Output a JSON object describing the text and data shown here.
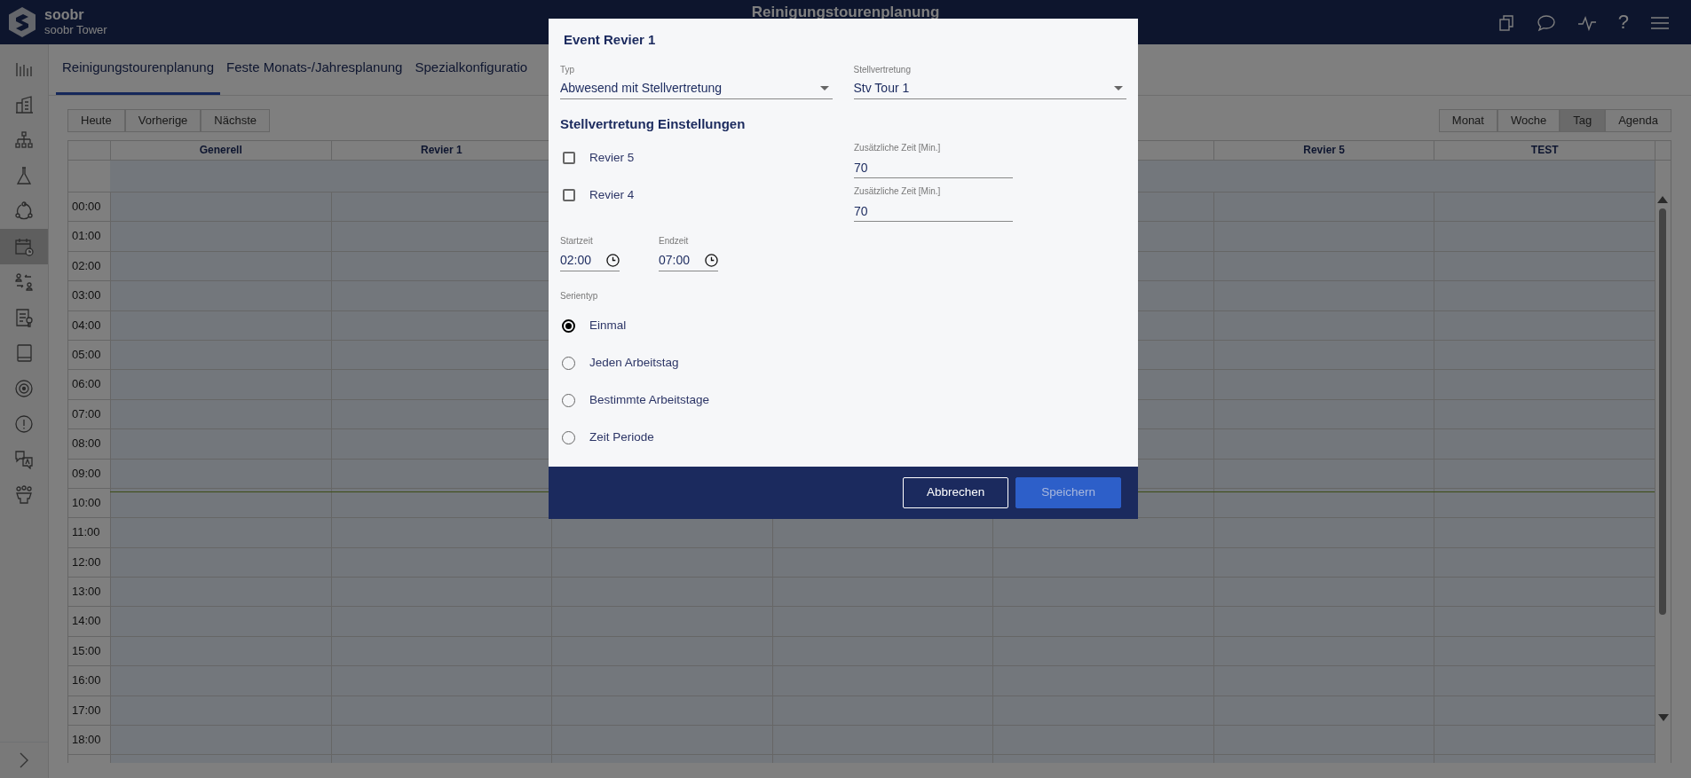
{
  "header": {
    "app_name": "soobr",
    "site": "soobr Tower",
    "title": "Reinigungstourenplanung",
    "help": "?"
  },
  "sidebar": {
    "items": [
      {
        "selected": false
      },
      {
        "selected": false
      },
      {
        "selected": false
      },
      {
        "selected": false
      },
      {
        "selected": false
      },
      {
        "selected": true
      },
      {
        "selected": false
      },
      {
        "selected": false
      },
      {
        "selected": false
      },
      {
        "selected": false
      },
      {
        "selected": false
      },
      {
        "selected": false
      },
      {
        "selected": false
      }
    ]
  },
  "tabs": [
    {
      "label": "Reinigungstourenplanung",
      "selected": true
    },
    {
      "label": "Feste Monats-/Jahresplanung",
      "selected": false
    },
    {
      "label": "Spezialkonfiguratio",
      "selected": false
    }
  ],
  "nav_buttons": [
    "Heute",
    "Vorherige",
    "Nächste"
  ],
  "views": [
    {
      "label": "Monat",
      "selected": false
    },
    {
      "label": "Woche",
      "selected": false
    },
    {
      "label": "Tag",
      "selected": true
    },
    {
      "label": "Agenda",
      "selected": false
    }
  ],
  "calendar": {
    "columns_left": [
      "Generell",
      "Revier 1"
    ],
    "columns_right": [
      "Revier 5",
      "TEST"
    ],
    "times": [
      "00:00",
      "01:00",
      "02:00",
      "03:00",
      "04:00",
      "05:00",
      "06:00",
      "07:00",
      "08:00",
      "09:00",
      "10:00",
      "11:00",
      "12:00",
      "13:00",
      "14:00",
      "15:00",
      "16:00",
      "17:00",
      "18:00"
    ]
  },
  "dialog": {
    "title": "Event Revier 1",
    "typ": {
      "label": "Typ",
      "value": "Abwesend mit Stellvertretung"
    },
    "stellvertretung": {
      "label": "Stellvertretung",
      "value": "Stv Tour 1"
    },
    "section_title": "Stellvertretung Einstellungen",
    "reviere": [
      {
        "label": "Revier 5",
        "checked": false,
        "extra_label": "Zusätzliche Zeit [Min.]",
        "extra_value": "70"
      },
      {
        "label": "Revier 4",
        "checked": false,
        "extra_label": "Zusätzliche Zeit [Min.]",
        "extra_value": "70"
      }
    ],
    "start": {
      "label": "Startzeit",
      "value": "02:00"
    },
    "end": {
      "label": "Endzeit",
      "value": "07:00"
    },
    "series": {
      "label": "Serientyp",
      "options": [
        {
          "label": "Einmal",
          "selected": true
        },
        {
          "label": "Jeden Arbeitstag",
          "selected": false
        },
        {
          "label": "Bestimmte Arbeitstage",
          "selected": false
        },
        {
          "label": "Zeit Periode",
          "selected": false
        }
      ]
    },
    "buttons": [
      {
        "label": "Abbrechen",
        "kind": "outline",
        "disabled": false
      },
      {
        "label": "Speichern",
        "kind": "primary",
        "disabled": true
      }
    ]
  }
}
